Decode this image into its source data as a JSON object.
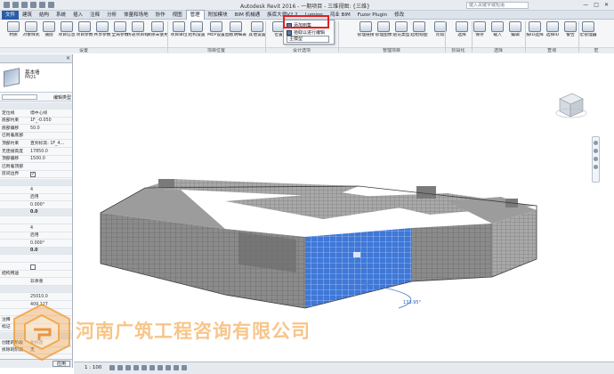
{
  "window": {
    "doc_title": "Autodesk Revit 2016 - 一期项目 - 三维视图: {三维}",
    "search_placeholder": "键入关键字或短语",
    "controls": [
      "—",
      "□",
      "✕"
    ]
  },
  "menu_tabs": [
    {
      "label": "文件",
      "active": false
    },
    {
      "label": "建筑",
      "active": false
    },
    {
      "label": "结构",
      "active": false
    },
    {
      "label": "系统",
      "active": false
    },
    {
      "label": "插入",
      "active": false
    },
    {
      "label": "注释",
      "active": false
    },
    {
      "label": "分析",
      "active": false
    },
    {
      "label": "体量和场地",
      "active": false
    },
    {
      "label": "协作",
      "active": false
    },
    {
      "label": "视图",
      "active": false
    },
    {
      "label": "管理",
      "active": true
    },
    {
      "label": "附加模块",
      "active": false
    },
    {
      "label": "BIM 机械通",
      "active": false
    },
    {
      "label": "族库大师V2.2",
      "active": false
    },
    {
      "label": "Lumion",
      "active": false
    },
    {
      "label": "鸿业 BIM",
      "active": false
    },
    {
      "label": "Fuzor Plugin",
      "active": false
    },
    {
      "label": "修改",
      "active": false
    }
  ],
  "ribbon": {
    "buttons": [
      "材质",
      "对象样式",
      "捕捉",
      "项目信息",
      "项目参数",
      "共享参数",
      "全局参数",
      "传递项目标准",
      "清除未使用项",
      "项目单位",
      "结构设置",
      "MEP设置",
      "面板明细表样板",
      "其他设置",
      "位置",
      "坐标",
      "位置",
      "设计选项",
      "主模型",
      "管理链接",
      "管理图像",
      "贴花类型",
      "起始视图",
      "阶段",
      "选择",
      "保存",
      "载入",
      "编辑",
      "按ID选择",
      "选择ID",
      "警告",
      "宏管理器",
      "宏安全性"
    ],
    "panel_labels": [
      "设置",
      "项目位置",
      "设计选项",
      "管理项目",
      "阶段化",
      "选择",
      "查询",
      "宏"
    ],
    "dropdown": {
      "item_1": "添加到集",
      "item_2": "拾取以进行编辑",
      "select_value": "主模型"
    }
  },
  "properties": {
    "close": "×",
    "type_name": "基本墙",
    "type_sub": "MQ1",
    "edit_type": "编辑类型",
    "rows": [
      {
        "k": "",
        "v": "",
        "sec": true
      },
      {
        "k": "定位线",
        "v": "墙中心线"
      },
      {
        "k": "底部约束",
        "v": "1F_-0.050"
      },
      {
        "k": "底部偏移",
        "v": "50.0"
      },
      {
        "k": "已附着底部",
        "v": ""
      },
      {
        "k": "顶部约束",
        "v": "直到标高: 1F_4..."
      },
      {
        "k": "无连接高度",
        "v": "17850.0"
      },
      {
        "k": "顶部偏移",
        "v": "1500.0"
      },
      {
        "k": "已附着顶部",
        "v": ""
      },
      {
        "k": "房间边界",
        "v": "",
        "chk": true
      },
      {
        "k": "",
        "v": "",
        "sec": true
      },
      {
        "k": "",
        "v": "4"
      },
      {
        "k": "",
        "v": "启用"
      },
      {
        "k": "",
        "v": "0.000°"
      },
      {
        "k": "",
        "v": "0.0",
        "sec": true
      },
      {
        "k": "",
        "v": ""
      },
      {
        "k": "",
        "v": "4"
      },
      {
        "k": "",
        "v": "启用"
      },
      {
        "k": "",
        "v": "0.000°"
      },
      {
        "k": "",
        "v": "0.0",
        "sec": true
      },
      {
        "k": "",
        "v": ""
      },
      {
        "k": "",
        "v": "",
        "chk": false
      },
      {
        "k": "结构用途",
        "v": ""
      },
      {
        "k": "",
        "v": "非承重"
      },
      {
        "k": "",
        "v": "",
        "sec": true
      },
      {
        "k": "",
        "v": "25010.0"
      },
      {
        "k": "",
        "v": "409.127"
      },
      {
        "k": "",
        "v": ""
      },
      {
        "k": "注释",
        "v": ""
      },
      {
        "k": "标记",
        "v": ""
      },
      {
        "k": "",
        "v": "",
        "sec": true
      },
      {
        "k": "创建的阶段",
        "v": "新构造"
      },
      {
        "k": "拆除的阶段",
        "v": "无"
      }
    ],
    "apply": "应用"
  },
  "viewport": {
    "dimension_text": "133.95°"
  },
  "status": {
    "scale": "1 : 100"
  },
  "watermark": {
    "text": "河南广筑工程咨询有限公司"
  },
  "colors": {
    "ribbon_bg": "#f4f6f8",
    "highlight": "#e02020",
    "curtain_wall": "#3f78d8",
    "watermark": "#f09628"
  }
}
